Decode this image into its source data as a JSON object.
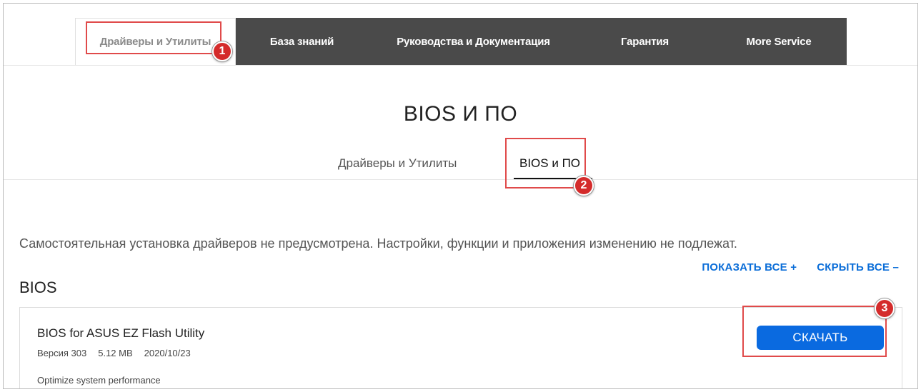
{
  "nav": {
    "tabs": [
      {
        "label": "Драйверы и Утилиты",
        "active": true
      },
      {
        "label": "База знаний"
      },
      {
        "label": "Руководства и Документация"
      },
      {
        "label": "Гарантия"
      },
      {
        "label": "More Service"
      }
    ]
  },
  "page": {
    "title": "BIOS И ПО",
    "subtabs": [
      {
        "label": "Драйверы и Утилиты"
      },
      {
        "label": "BIOS и ПО",
        "active": true
      }
    ],
    "notice": "Самостоятельная установка драйверов не предусмотрена. Настройки, функции и приложения изменению не подлежат.",
    "show_all": "ПОКАЗАТЬ ВСЕ +",
    "hide_all": "СКРЫТЬ ВСЕ –",
    "section_title": "BIOS"
  },
  "item": {
    "title": "BIOS for ASUS EZ Flash Utility",
    "version": "Версия 303",
    "size": "5.12 MB",
    "date": "2020/10/23",
    "description": "Optimize system performance",
    "download_label": "СКАЧАТЬ"
  },
  "annotations": {
    "badge_1": "1",
    "badge_2": "2",
    "badge_3": "3",
    "color": "#d42b2b"
  },
  "colors": {
    "nav_bg": "#4a4a4a",
    "link": "#0a6dd8",
    "button": "#0a6ae0"
  }
}
